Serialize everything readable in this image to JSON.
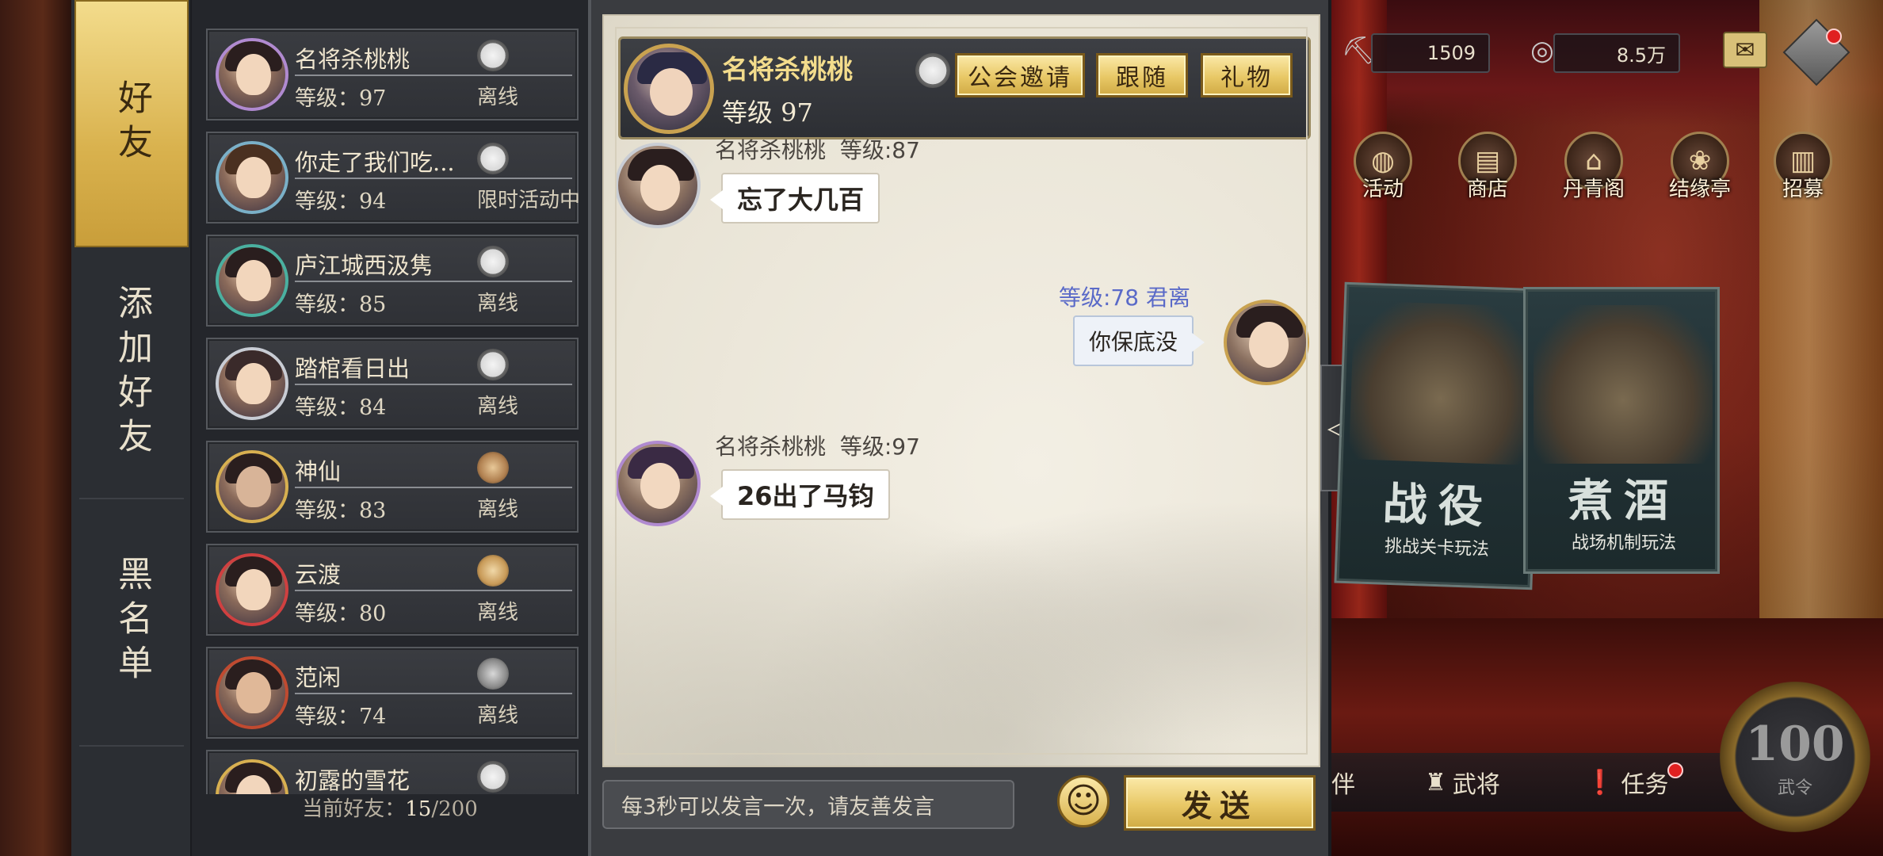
{
  "tabs": [
    {
      "label": "好友",
      "active": true
    },
    {
      "label": "添加好友",
      "active": false
    },
    {
      "label": "黑名单",
      "active": false
    }
  ],
  "friends": [
    {
      "name": "名将杀桃桃",
      "level": "等级：97",
      "status": "离线",
      "pet": "panda-icon"
    },
    {
      "name": "你走了我们吃...",
      "level": "等级：94",
      "status": "限时活动中",
      "pet": "panda-icon"
    },
    {
      "name": "庐江城西汲隽",
      "level": "等级：85",
      "status": "离线",
      "pet": "panda-icon"
    },
    {
      "name": "踏棺看日出",
      "level": "等级：84",
      "status": "离线",
      "pet": "panda-icon"
    },
    {
      "name": "神仙",
      "level": "等级：83",
      "status": "离线",
      "pet": "dog-icon"
    },
    {
      "name": "云渡",
      "level": "等级：80",
      "status": "离线",
      "pet": "fox-icon"
    },
    {
      "name": "范闲",
      "level": "等级：74",
      "status": "离线",
      "pet": "wolf-icon"
    },
    {
      "name": "初露的雪花",
      "level": "",
      "status": "",
      "pet": "panda-icon"
    }
  ],
  "friend_count": {
    "label": "当前好友：",
    "current": "15",
    "total": "/200"
  },
  "chat": {
    "header": {
      "name": "名将杀桃桃",
      "level": "等级 97",
      "buttons": {
        "guild_invite": "公会邀请",
        "follow": "跟随",
        "gift": "礼物"
      }
    },
    "messages": [
      {
        "sender": "名将杀桃桃",
        "level": "等级:87",
        "text": "忘了大几百",
        "mine": false
      },
      {
        "sender": "君离",
        "level": "等级:78",
        "text": "你保底没",
        "mine": true
      },
      {
        "sender": "名将杀桃桃",
        "level": "等级:97",
        "text": "26出了马钧",
        "mine": false
      }
    ],
    "input_placeholder": "每3秒可以发言一次，请友善发言",
    "emoji_icon": "☺",
    "send_label": "发送",
    "collapse_icon": "◁"
  },
  "hud": {
    "resource_1": "1509",
    "resource_2": "8.5万",
    "menu": [
      {
        "label": "活动",
        "icon": "lantern-icon"
      },
      {
        "label": "商店",
        "icon": "shop-icon"
      },
      {
        "label": "丹青阁",
        "icon": "pavilion-icon"
      },
      {
        "label": "结缘亭",
        "icon": "cat-icon"
      },
      {
        "label": "招募",
        "icon": "scroll-icon"
      }
    ],
    "cards": [
      {
        "title": "战役",
        "subtitle": "挑战关卡玩法"
      },
      {
        "title": "煮酒",
        "subtitle": "战场机制玩法"
      }
    ],
    "bottom": {
      "partial": "伴",
      "generals": "武将",
      "tasks": "任务"
    },
    "badge_number": "100",
    "badge_sub": "武令"
  },
  "colors": {
    "gold": "#e8c866",
    "panel": "#2b2e33",
    "paper": "#f3efe4",
    "my_name": "#5a6ac8"
  }
}
